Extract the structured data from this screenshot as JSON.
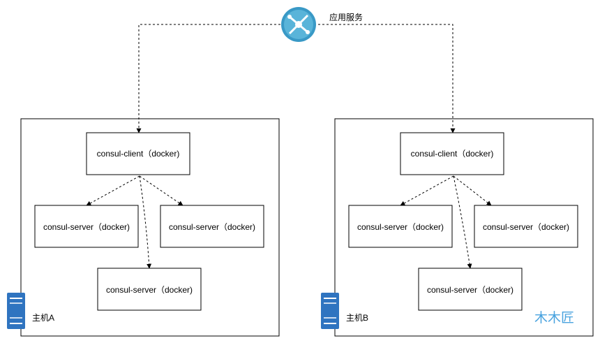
{
  "service": {
    "label": "应用服务",
    "icon": "azure-service-fabric-icon",
    "icon_color": "#3999c6"
  },
  "hosts": [
    {
      "label": "主机A",
      "icon": "server-icon",
      "client": "consul-client（docker)",
      "servers": [
        "consul-server（docker)",
        "consul-server（docker)",
        "consul-server（docker)"
      ]
    },
    {
      "label": "主机B",
      "icon": "server-icon",
      "client": "consul-client（docker)",
      "servers": [
        "consul-server（docker)",
        "consul-server（docker)",
        "consul-server（docker)"
      ]
    }
  ],
  "watermark": "木木匠",
  "colors": {
    "server_icon": "#2f74c0",
    "watermark": "#4aa3df",
    "line": "#000000"
  }
}
